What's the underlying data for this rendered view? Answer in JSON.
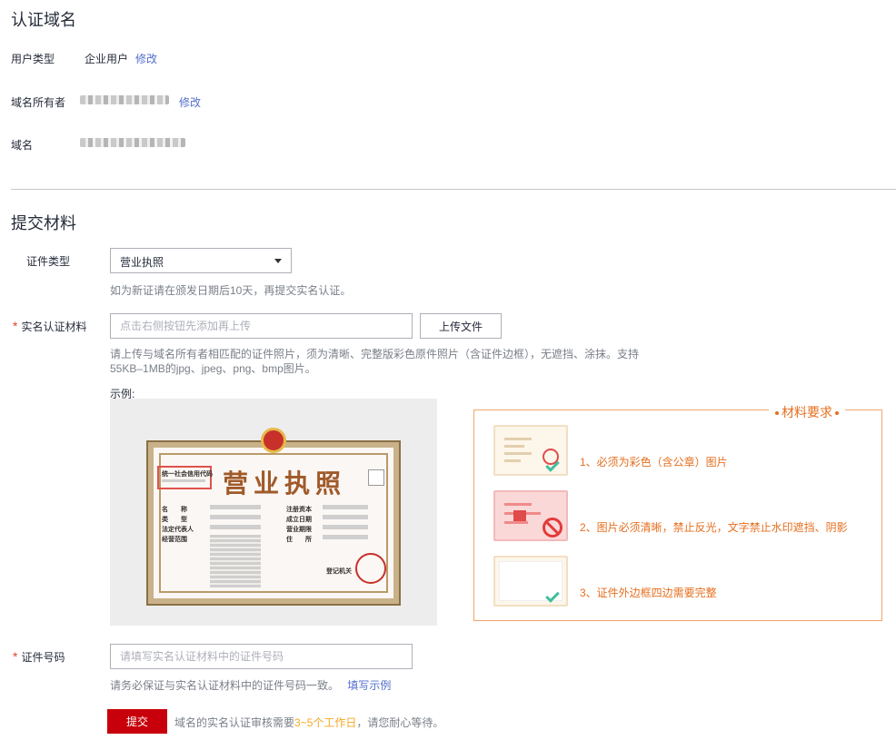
{
  "verify": {
    "title": "认证域名",
    "user_type_label": "用户类型",
    "user_type_value": "企业用户",
    "modify1": "修改",
    "owner_label": "域名所有者",
    "modify2": "修改",
    "domain_label": "域名"
  },
  "submit": {
    "title": "提交材料",
    "cert_type_label": "证件类型",
    "cert_type_value": "营业执照",
    "cert_type_hint": "如为新证请在颁发日期后10天，再提交实名认证。",
    "material_label": "实名认证材料",
    "material_placeholder": "点击右侧按钮先添加再上传",
    "upload_button": "上传文件",
    "material_hint_line1": "请上传与域名所有者相匹配的证件照片，须为清晰、完整版彩色原件照片（含证件边框），无遮挡、涂抹。支持",
    "material_hint_line2": "55KB–1MB的jpg、jpeg、png、bmp图片。",
    "example_label": "示例:",
    "cert_no_label": "证件号码",
    "cert_no_placeholder": "请填写实名认证材料中的证件号码",
    "cert_no_hint": "请务必保证与实名认证材料中的证件号码一致。",
    "fill_example_link": "填写示例",
    "submit_button": "提交",
    "review_prefix": "域名的实名认证审核需要",
    "review_days": "3~5个工作日",
    "review_suffix": "，请您耐心等待。"
  },
  "license_example": {
    "title": "营业执照",
    "code_label": "统一社会信用代码",
    "fields_left": [
      "名　　称",
      "类　　型",
      "法定代表人",
      "经营范围"
    ],
    "fields_right": [
      "注册资本",
      "成立日期",
      "营业期限",
      "住　　所"
    ],
    "authority": "登记机关"
  },
  "requirements": {
    "legend": "材料要求",
    "items": [
      "1、必须为彩色（含公章）图片",
      "2、图片必须清晰，禁止反光，文字禁止水印遮挡、阴影",
      "3、证件外边框四边需要完整"
    ]
  },
  "colors": {
    "link": "#526ecc",
    "primary": "#c7000b",
    "required": "#e0432f",
    "requirement_accent": "#e56f1f",
    "days_highlight": "#f5a623"
  }
}
